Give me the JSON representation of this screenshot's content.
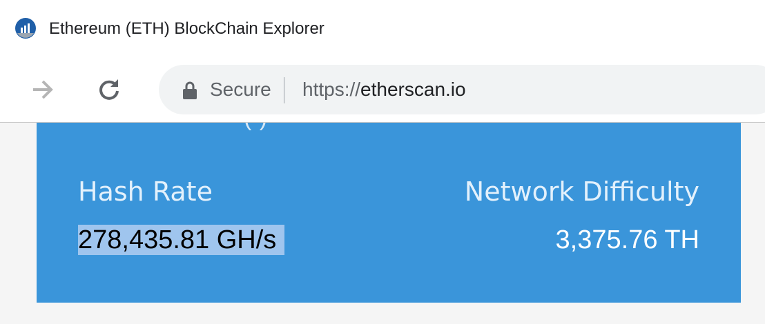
{
  "tab": {
    "title": "Ethereum (ETH) BlockChain Explorer",
    "favicon": "etherscan-logo"
  },
  "toolbar": {
    "forward_icon": "arrow-right-icon",
    "reload_icon": "reload-icon",
    "security_label": "Secure",
    "url_scheme": "https://",
    "url_host": "etherscan.io"
  },
  "stats": {
    "cut_off_text": "(      )",
    "hash_rate_label": "Hash Rate",
    "hash_rate_value": "278,435.81 GH/s",
    "difficulty_label": "Network Difficulty",
    "difficulty_value": "3,375.76 TH"
  },
  "colors": {
    "card_background": "#3a95da",
    "selection_highlight": "#9fc5ee",
    "page_background": "#f5f5f5",
    "favicon": "#1f5fa8"
  }
}
